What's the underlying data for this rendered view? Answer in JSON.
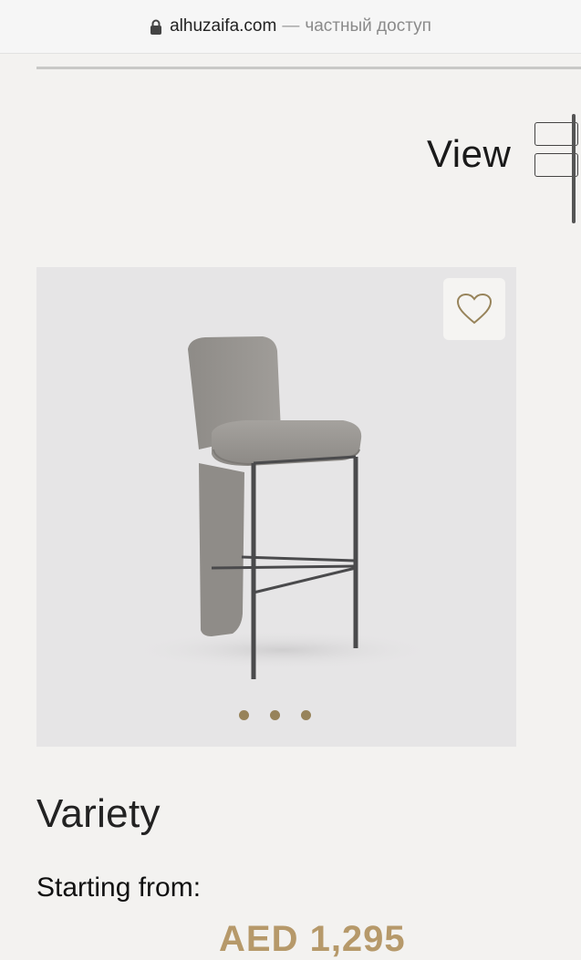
{
  "browser": {
    "domain": "alhuzaifa.com",
    "separator": "—",
    "access_text": "частный доступ",
    "lock_icon": "lock-icon"
  },
  "toolbar": {
    "view_label": "View",
    "view_icon": "list-view-icon"
  },
  "product": {
    "wishlist_icon": "heart-outline-icon",
    "carousel_dots": 3,
    "title": "Variety",
    "starting_label": "Starting from:",
    "price": "AED 1,295"
  },
  "colors": {
    "accent": "#97835a",
    "price": "#b6996a",
    "background": "#f3f2f0",
    "card_bg": "#e6e5e6"
  }
}
